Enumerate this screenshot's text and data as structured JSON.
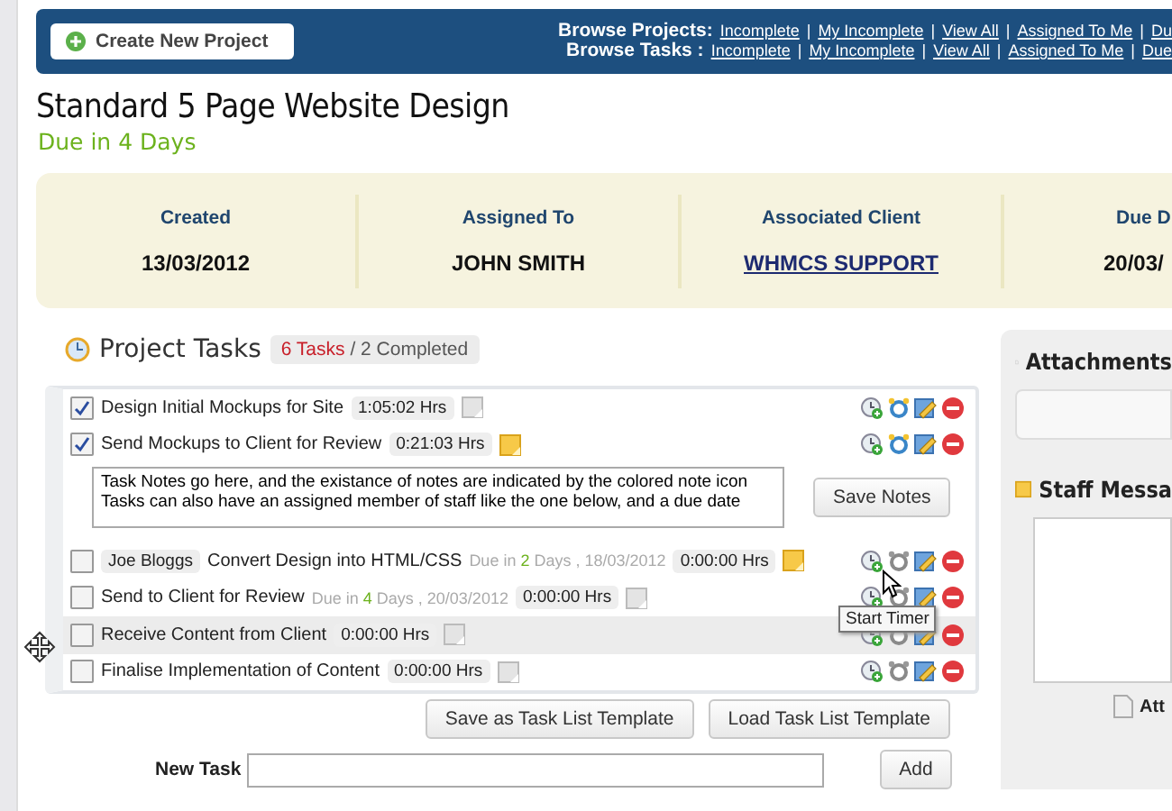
{
  "header": {
    "create_button": "Create New Project",
    "separator": "|",
    "nav": [
      {
        "label": "Browse Projects:",
        "links": [
          "Incomplete",
          "My Incomplete",
          "View All",
          "Assigned To Me",
          "Du"
        ]
      },
      {
        "label": "Browse Tasks :",
        "links": [
          "Incomplete",
          "My Incomplete",
          "View All",
          "Assigned To Me",
          "Due"
        ]
      }
    ]
  },
  "project": {
    "title": "Standard 5 Page Website Design",
    "due": "Due in 4 Days"
  },
  "info": [
    {
      "label": "Created",
      "value": "13/03/2012",
      "kind": "text"
    },
    {
      "label": "Assigned To",
      "value": "JOHN SMITH",
      "kind": "text"
    },
    {
      "label": "Associated Client",
      "value": "WHMCS SUPPORT",
      "kind": "link"
    },
    {
      "label": "Due D",
      "value": "20/03/",
      "kind": "text"
    }
  ],
  "tasks": {
    "title": "Project Tasks",
    "count": "6 Tasks",
    "completed": "/ 2 Completed",
    "tooltip": "Start Timer",
    "rows": [
      {
        "title": "Design Initial Mockups for Site",
        "checked": true,
        "time": "1:05:02 Hrs",
        "has_notes": false,
        "timer_active": true,
        "highlighted": false
      },
      {
        "title": "Send Mockups to Client for Review",
        "checked": true,
        "time": "0:21:03 Hrs",
        "has_notes": true,
        "timer_active": true,
        "highlighted": false,
        "notes": "Task Notes go here, and the existance of notes are indicated by the colored note icon\nTasks can also have an assigned member of staff like the one below, and a due date",
        "notes_button": "Save Notes"
      },
      {
        "title": "Convert Design into HTML/CSS",
        "checked": false,
        "assignee": "Joe Bloggs",
        "due": {
          "prefix": "Due in",
          "days": "2",
          "suffix": "Days , 18/03/2012"
        },
        "time": "0:00:00 Hrs",
        "has_notes": true,
        "timer_active": false,
        "highlighted": false
      },
      {
        "title": "Send to Client for Review",
        "checked": false,
        "due": {
          "prefix": "Due in",
          "days": "4",
          "suffix": "Days , 20/03/2012"
        },
        "time": "0:00:00 Hrs",
        "has_notes": false,
        "timer_active": false,
        "highlighted": false
      },
      {
        "title": "Receive Content from Client",
        "checked": false,
        "time": "0:00:00 Hrs",
        "has_notes": false,
        "timer_active": false,
        "highlighted": true
      },
      {
        "title": "Finalise Implementation of Content",
        "checked": false,
        "time": "0:00:00 Hrs",
        "has_notes": false,
        "timer_active": false,
        "highlighted": false
      }
    ]
  },
  "template_buttons": [
    "Save as Task List Template",
    "Load Task List Template"
  ],
  "new_task": {
    "label": "New Task",
    "button": "Add"
  },
  "sidebar": {
    "attachments_title": "Attachments",
    "messages_title": "Staff Messa",
    "footer": "Att"
  }
}
